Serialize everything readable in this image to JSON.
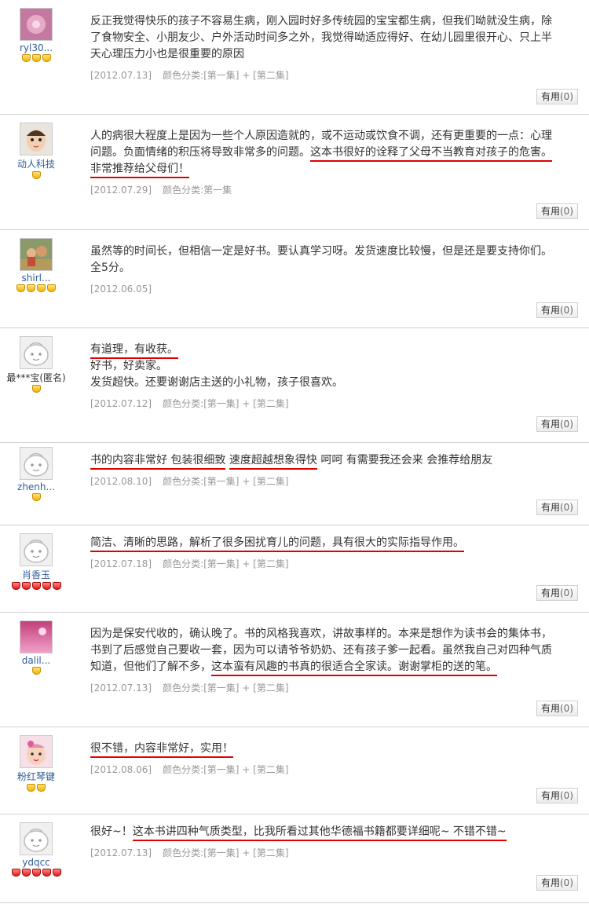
{
  "reviews": [
    {
      "user": "ryl30...",
      "badge_type": "gold",
      "badge_count": 3,
      "avatar": "pink-flower",
      "paragraphs": [
        [
          {
            "t": "反正我觉得快乐的孩子不容易生病，刚入园时好多传统园的宝宝都生病，但我们呦就没生病，除了食物安全、小朋友少、户外活动时间多之外，我觉得呦适应得好、在幼儿园里很开心、只上半天心理压力小也是很重要的原因",
            "u": false
          }
        ]
      ],
      "date": "[2012.07.13]",
      "color_label": "颜色分类:",
      "color_value": "[第一集] + [第二集]",
      "useful_label": "有用",
      "useful_count": "(0)"
    },
    {
      "user": "动人科技",
      "badge_type": "gold",
      "badge_count": 1,
      "avatar": "baby-face",
      "paragraphs": [
        [
          {
            "t": "人的病很大程度上是因为一些个人原因造就的，或不运动或饮食不调，还有更重要的一点：心理问题。负面情绪的积压将导致非常多的问题。",
            "u": false
          },
          {
            "t": "这本书很好的诠释了父母不当教育对孩子的危害。非常推荐给父母们！",
            "u": true
          }
        ]
      ],
      "date": "[2012.07.29]",
      "color_label": "颜色分类:",
      "color_value": "第一集",
      "useful_label": "有用",
      "useful_count": "(0)"
    },
    {
      "user": "shirl...",
      "badge_type": "gold",
      "badge_count": 4,
      "avatar": "photo",
      "paragraphs": [
        [
          {
            "t": "虽然等的时间长，但相信一定是好书。要认真学习呀。发货速度比较慢，但是还是要支持你们。全5分。",
            "u": false
          }
        ]
      ],
      "date": "[2012.06.05]",
      "color_label": "",
      "color_value": "",
      "useful_label": "有用",
      "useful_count": "(0)"
    },
    {
      "user": "最***宝(匿名)",
      "badge_type": "gold",
      "badge_count": 1,
      "avatar": "default",
      "paragraphs": [
        [
          {
            "t": "有道理，有收获。",
            "u": true
          }
        ],
        [
          {
            "t": "好书，好卖家。",
            "u": false
          }
        ],
        [
          {
            "t": "发货超快。还要谢谢店主送的小礼物，孩子很喜欢。",
            "u": false
          }
        ]
      ],
      "date": "[2012.07.12]",
      "color_label": "颜色分类:",
      "color_value": "[第一集] + [第二集]",
      "useful_label": "有用",
      "useful_count": "(0)"
    },
    {
      "user": "zhenh...",
      "badge_type": "gold",
      "badge_count": 1,
      "avatar": "default",
      "paragraphs": [
        [
          {
            "t": "书的内容非常好 包装很细致",
            "u": true
          },
          {
            "t": " ",
            "u": false
          },
          {
            "t": "速度超越想象得快",
            "u": true
          },
          {
            "t": " 呵呵 有需要我还会来 会推荐给朋友",
            "u": false
          }
        ]
      ],
      "date": "[2012.08.10]",
      "color_label": "颜色分类:",
      "color_value": "[第一集] + [第二集]",
      "useful_label": "有用",
      "useful_count": "(0)"
    },
    {
      "user": "肖香玉",
      "badge_type": "red",
      "badge_count": 5,
      "avatar": "default",
      "paragraphs": [
        [
          {
            "t": "简洁、清晰的思路，解析了很多困扰育儿的问题，具有很大的实际指导作用。",
            "u": true
          }
        ]
      ],
      "date": "[2012.07.18]",
      "color_label": "颜色分类:",
      "color_value": "[第一集] + [第二集]",
      "useful_label": "有用",
      "useful_count": "(0)"
    },
    {
      "user": "dalil...",
      "badge_type": "gold",
      "badge_count": 1,
      "avatar": "pink-sky",
      "paragraphs": [
        [
          {
            "t": "因为是保安代收的，确认晚了。书的风格我喜欢，讲故事样的。本来是想作为读书会的集体书，书到了后感觉自己要收一套，因为可以请爷爷奶奶、还有孩子爹一起看。虽然我自己对四种气质知道，但他们了解不多，",
            "u": false
          },
          {
            "t": "这本蛮有风趣的书真的很适合全家读。谢谢掌柜的送的笔。",
            "u": true
          }
        ]
      ],
      "date": "[2012.07.13]",
      "color_label": "颜色分类:",
      "color_value": "[第一集] + [第二集]",
      "useful_label": "有用",
      "useful_count": "(0)"
    },
    {
      "user": "粉红琴键",
      "badge_type": "gold",
      "badge_count": 2,
      "avatar": "baby-pink",
      "paragraphs": [
        [
          {
            "t": "很不错，内容非常好，实用！",
            "u": true
          }
        ]
      ],
      "date": "[2012.08.06]",
      "color_label": "颜色分类:",
      "color_value": "[第一集] + [第二集]",
      "useful_label": "有用",
      "useful_count": "(0)"
    },
    {
      "user": "ydqcc",
      "badge_type": "red",
      "badge_count": 5,
      "avatar": "default",
      "paragraphs": [
        [
          {
            "t": "很好~！",
            "u": false
          },
          {
            "t": "这本书讲四种气质类型，比我所看过其他华德福书籍都要详细呢~ 不错不错~",
            "u": true
          }
        ]
      ],
      "date": "[2012.07.13]",
      "color_label": "颜色分类:",
      "color_value": "[第一集] + [第二集]",
      "useful_label": "有用",
      "useful_count": "(0)"
    }
  ],
  "colors": {
    "username": "#2f5d99",
    "underline": "#e00000",
    "meta": "#999999",
    "separator": "#d0d0d0"
  }
}
